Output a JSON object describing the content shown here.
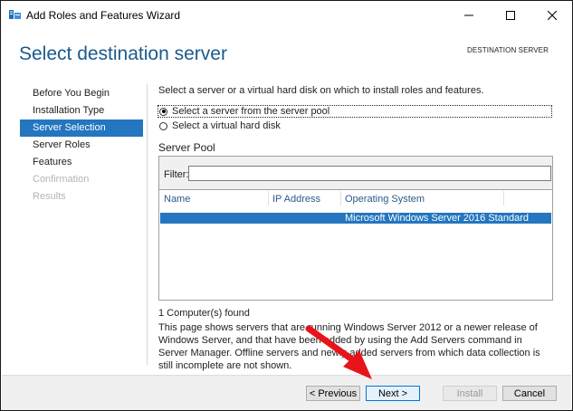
{
  "window": {
    "title": "Add Roles and Features Wizard"
  },
  "header": {
    "title": "Select destination server",
    "destination_label": "DESTINATION SERVER"
  },
  "nav": {
    "items": [
      {
        "label": "Before You Begin",
        "state": "normal"
      },
      {
        "label": "Installation Type",
        "state": "normal"
      },
      {
        "label": "Server Selection",
        "state": "active"
      },
      {
        "label": "Server Roles",
        "state": "normal"
      },
      {
        "label": "Features",
        "state": "normal"
      },
      {
        "label": "Confirmation",
        "state": "disabled"
      },
      {
        "label": "Results",
        "state": "disabled"
      }
    ]
  },
  "content": {
    "intro": "Select a server or a virtual hard disk on which to install roles and features.",
    "options": [
      {
        "label": "Select a server from the server pool",
        "checked": true
      },
      {
        "label": "Select a virtual hard disk",
        "checked": false
      }
    ],
    "pool": {
      "heading": "Server Pool",
      "filter_label": "Filter:",
      "filter_value": "",
      "columns": [
        "Name",
        "IP Address",
        "Operating System"
      ],
      "rows": [
        {
          "name": "",
          "ip": "",
          "os": "Microsoft Windows Server 2016 Standard"
        }
      ]
    },
    "found": "1 Computer(s) found",
    "description": "This page shows servers that are running Windows Server 2012 or a newer release of Windows Server, and that have been added by using the Add Servers command in Server Manager. Offline servers and newly-added servers from which data collection is still incomplete are not shown."
  },
  "footer": {
    "previous": "< Previous",
    "next": "Next >",
    "install": "Install",
    "cancel": "Cancel"
  },
  "colors": {
    "accent": "#2376bf",
    "title": "#1a5a8c",
    "arrow": "#e8141c"
  }
}
